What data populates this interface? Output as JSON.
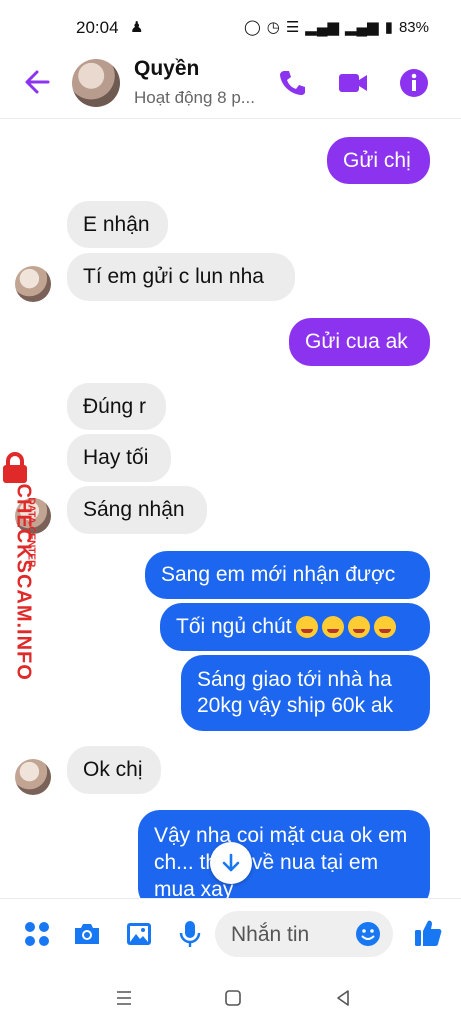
{
  "status_bar": {
    "time": "20:04",
    "battery": "83%"
  },
  "header": {
    "contact_name": "Quyền",
    "activity": "Hoạt động 8 p..."
  },
  "messages": [
    {
      "side": "out",
      "text": "Gửi chị"
    },
    {
      "side": "in",
      "text": "E nhận"
    },
    {
      "side": "in",
      "text": "Tí em gửi c lun nha"
    },
    {
      "side": "out",
      "text": "Gửi cua ak"
    },
    {
      "side": "in",
      "text": "Đúng r"
    },
    {
      "side": "in",
      "text": "Hay tối"
    },
    {
      "side": "in",
      "text": "Sáng nhận"
    },
    {
      "side": "out",
      "text": "Sang em mới nhận được"
    },
    {
      "side": "out",
      "text": "Tối ngủ chút"
    },
    {
      "side": "out",
      "text": "Sáng giao tới nhà ha 20kg vậy ship 60k ak"
    },
    {
      "side": "in",
      "text": "Ok chị"
    },
    {
      "side": "out",
      "text": "Vậy nha coi mặt cua ok em ch... thêm về nua tại em mua xay"
    }
  ],
  "watermark": {
    "text": "CHECKSCAM.INFO",
    "subtext": "DATA CENTER"
  },
  "composer": {
    "placeholder": "Nhắn tin"
  },
  "colors": {
    "accent": "#8c33f0",
    "outgoing_purple": "#8c33f0",
    "outgoing_blue": "#1d67f0",
    "incoming": "#ececec",
    "icon_blue": "#1877f2",
    "watermark": "#e02a2a"
  }
}
